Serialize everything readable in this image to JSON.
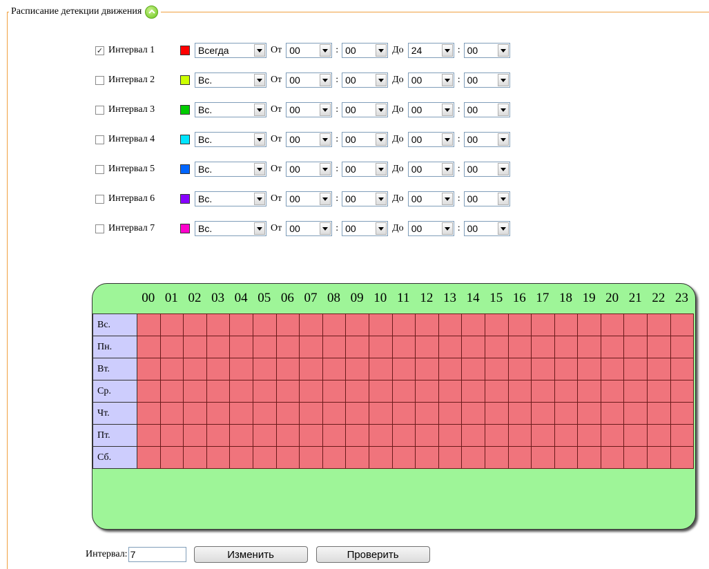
{
  "section": {
    "title": "Расписание детекции движения"
  },
  "intervals": [
    {
      "label": "Интервал 1",
      "checked": true,
      "color": "#ff0000",
      "day": "Всегда",
      "from_label": "От",
      "from_h": "00",
      "from_m": "00",
      "to_label": "До",
      "to_h": "24",
      "to_m": "00"
    },
    {
      "label": "Интервал 2",
      "checked": false,
      "color": "#ccff00",
      "day": "Вс.",
      "from_label": "От",
      "from_h": "00",
      "from_m": "00",
      "to_label": "До",
      "to_h": "00",
      "to_m": "00"
    },
    {
      "label": "Интервал 3",
      "checked": false,
      "color": "#00cc00",
      "day": "Вс.",
      "from_label": "От",
      "from_h": "00",
      "from_m": "00",
      "to_label": "До",
      "to_h": "00",
      "to_m": "00"
    },
    {
      "label": "Интервал 4",
      "checked": false,
      "color": "#00e5ff",
      "day": "Вс.",
      "from_label": "От",
      "from_h": "00",
      "from_m": "00",
      "to_label": "До",
      "to_h": "00",
      "to_m": "00"
    },
    {
      "label": "Интервал 5",
      "checked": false,
      "color": "#0066ff",
      "day": "Вс.",
      "from_label": "От",
      "from_h": "00",
      "from_m": "00",
      "to_label": "До",
      "to_h": "00",
      "to_m": "00"
    },
    {
      "label": "Интервал 6",
      "checked": false,
      "color": "#8800ff",
      "day": "Вс.",
      "from_label": "От",
      "from_h": "00",
      "from_m": "00",
      "to_label": "До",
      "to_h": "00",
      "to_m": "00"
    },
    {
      "label": "Интервал 7",
      "checked": false,
      "color": "#ff00cc",
      "day": "Вс.",
      "from_label": "От",
      "from_h": "00",
      "from_m": "00",
      "to_label": "До",
      "to_h": "00",
      "to_m": "00"
    }
  ],
  "schedule": {
    "hours": [
      "00",
      "01",
      "02",
      "03",
      "04",
      "05",
      "06",
      "07",
      "08",
      "09",
      "10",
      "11",
      "12",
      "13",
      "14",
      "15",
      "16",
      "17",
      "18",
      "19",
      "20",
      "21",
      "22",
      "23"
    ],
    "days": [
      "Вс.",
      "Пн.",
      "Вт.",
      "Ср.",
      "Чт.",
      "Пт.",
      "Сб."
    ],
    "filled_color": "#f0747c"
  },
  "footer": {
    "interval_label": "Интервал:",
    "interval_value": "7",
    "change_button": "Изменить",
    "check_button": "Проверить"
  }
}
